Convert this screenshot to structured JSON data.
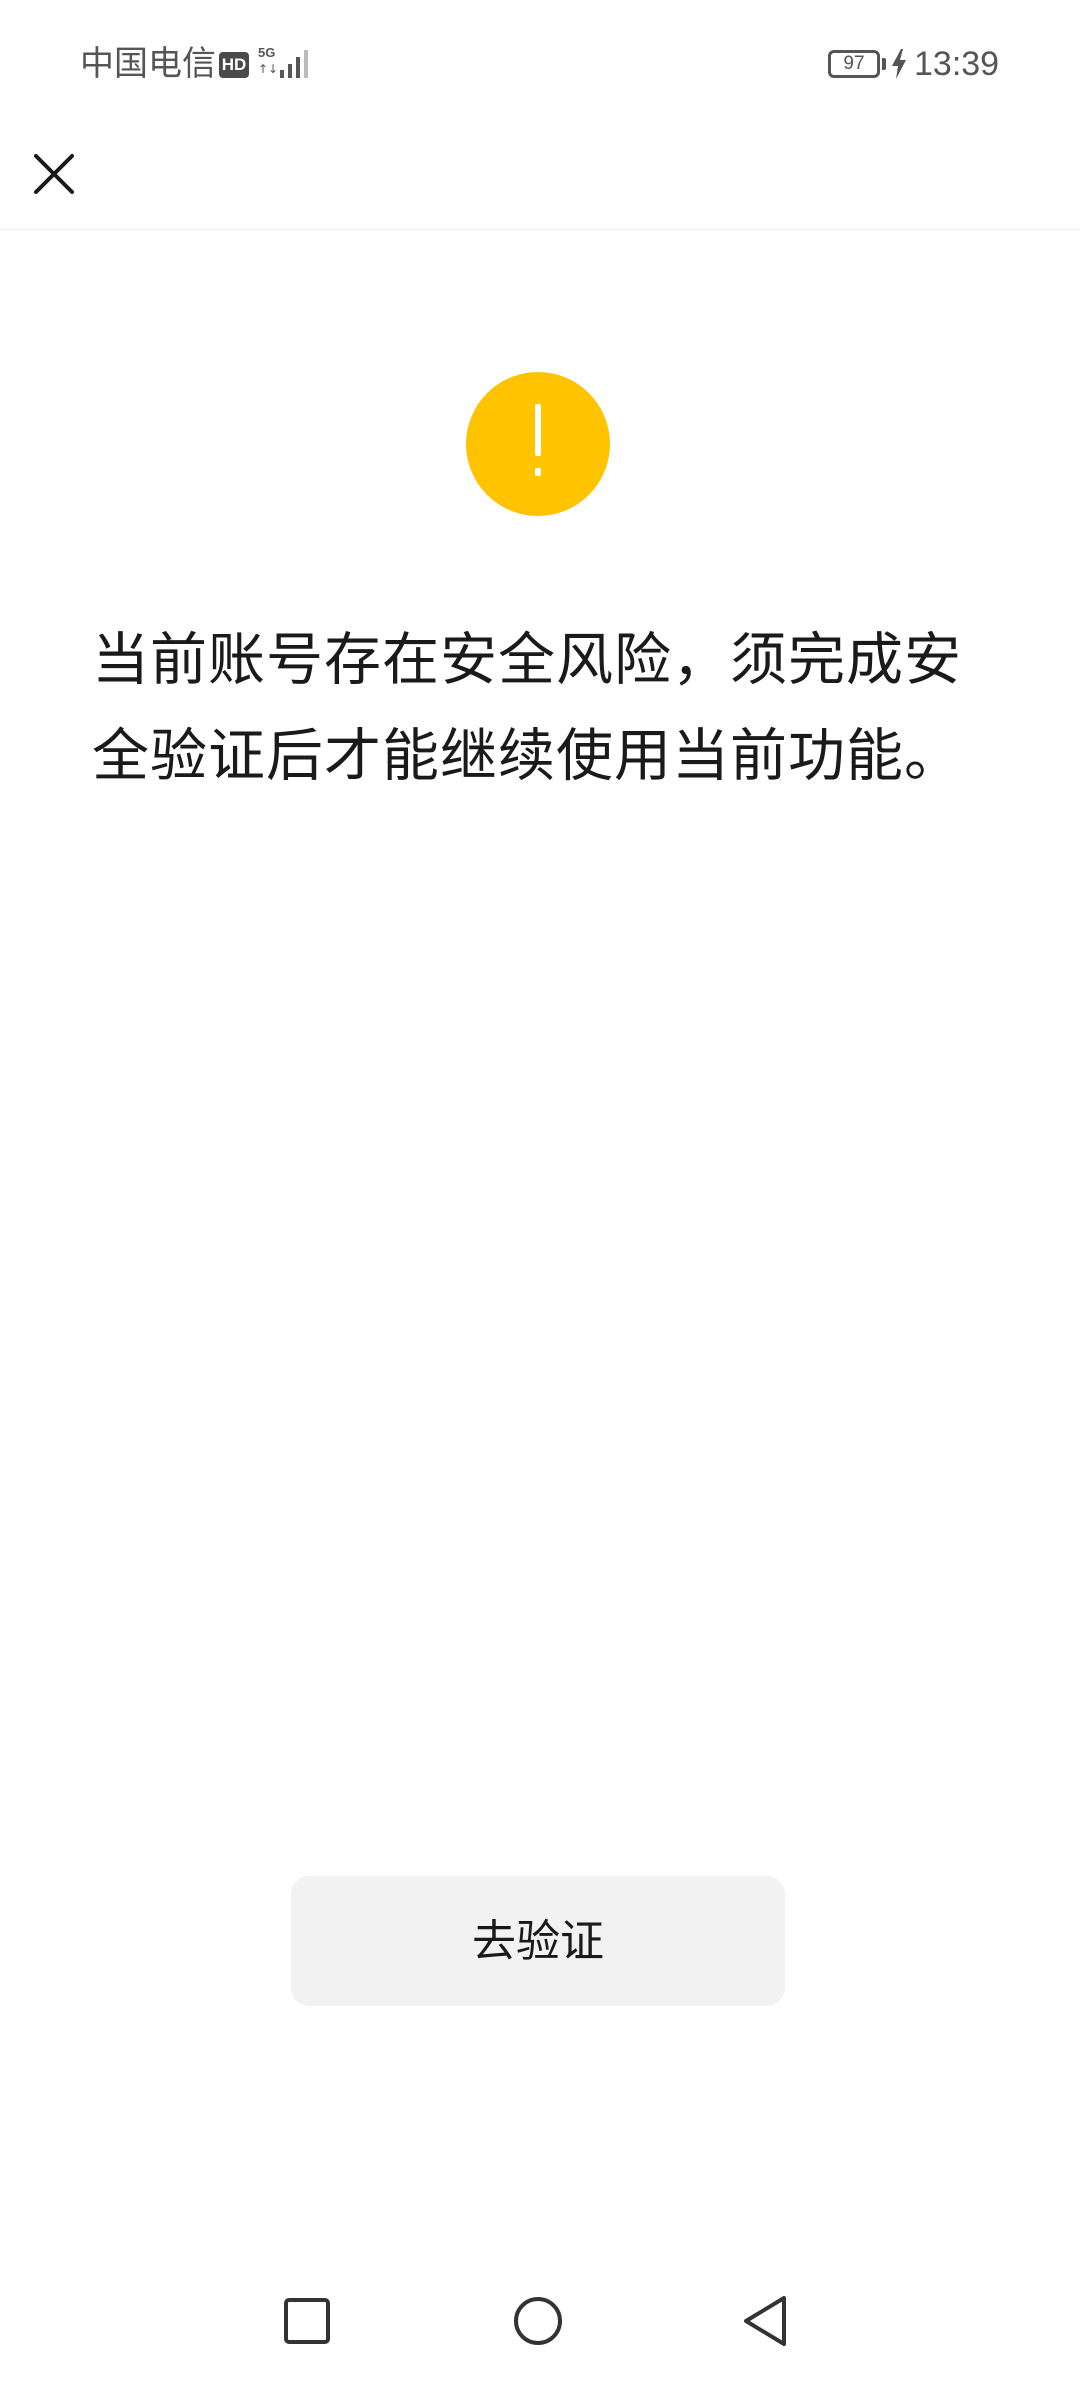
{
  "status_bar": {
    "carrier": "中国电信",
    "hd_badge": "HD",
    "network_type": "5G",
    "network_arrows": "↑↓",
    "battery_level": "97",
    "time": "13:39",
    "icons": [
      "hd-icon",
      "signal-icon",
      "battery-icon",
      "charging-icon"
    ]
  },
  "top_nav": {
    "close_icon": "close-icon"
  },
  "warning": {
    "icon": "exclamation-icon",
    "color": "#FFC300"
  },
  "message": {
    "text": "当前账号存在安全风险，须完成安全验证后才能继续使用当前功能。"
  },
  "verify_button": {
    "label": "去验证"
  },
  "nav_bar": {
    "buttons": [
      "recent-apps",
      "home",
      "back"
    ]
  }
}
